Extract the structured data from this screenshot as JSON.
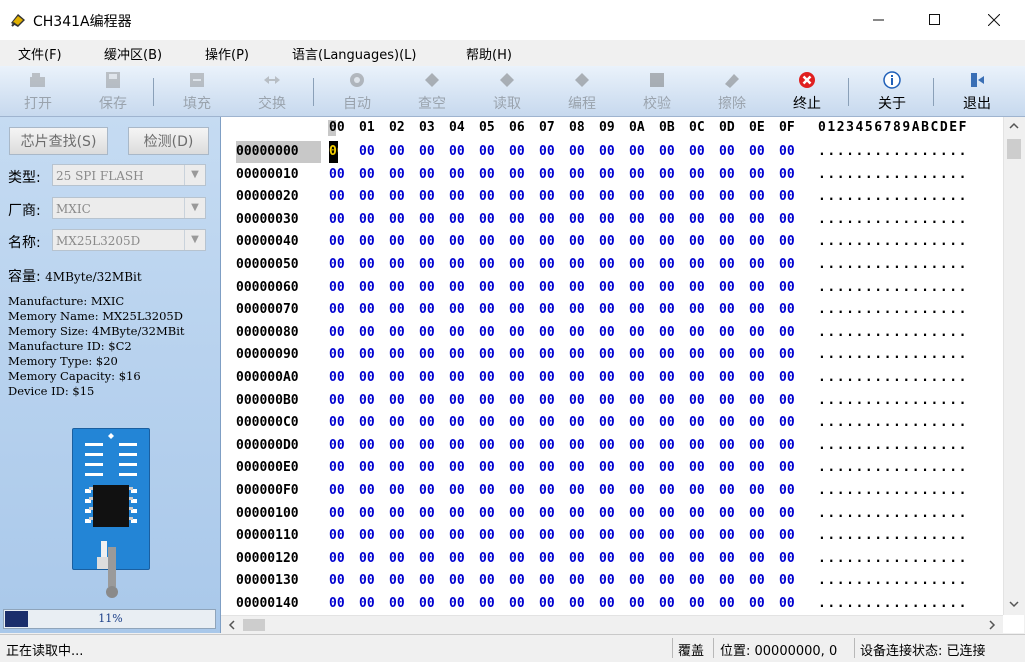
{
  "window": {
    "title": "CH341A编程器"
  },
  "menu": [
    "文件(F)",
    "缓冲区(B)",
    "操作(P)",
    "语言(Languages)(L)",
    "帮助(H)"
  ],
  "toolbar": [
    {
      "label": "打开",
      "icon": "open-icon",
      "enabled": false
    },
    {
      "label": "保存",
      "icon": "save-icon",
      "enabled": false
    },
    {
      "label": "填充",
      "icon": "fill-icon",
      "enabled": false
    },
    {
      "label": "交换",
      "icon": "swap-icon",
      "enabled": false
    },
    {
      "label": "自动",
      "icon": "auto-icon",
      "enabled": false
    },
    {
      "label": "查空",
      "icon": "blank-check-icon",
      "enabled": false
    },
    {
      "label": "读取",
      "icon": "read-icon",
      "enabled": false
    },
    {
      "label": "编程",
      "icon": "program-icon",
      "enabled": false
    },
    {
      "label": "校验",
      "icon": "verify-icon",
      "enabled": false
    },
    {
      "label": "擦除",
      "icon": "erase-icon",
      "enabled": false
    },
    {
      "label": "终止",
      "icon": "stop-icon",
      "enabled": true
    },
    {
      "label": "关于",
      "icon": "info-icon",
      "enabled": true
    },
    {
      "label": "退出",
      "icon": "exit-icon",
      "enabled": true
    }
  ],
  "left": {
    "chip_search": "芯片查找(S)",
    "detect": "检测(D)",
    "type_label": "类型:",
    "type_value": "25 SPI FLASH",
    "vendor_label": "厂商:",
    "vendor_value": "MXIC",
    "name_label": "名称:",
    "name_value": "MX25L3205D",
    "capacity_label": "容量:",
    "capacity_value": "4MByte/32MBit",
    "info": [
      "Manufacture: MXIC",
      "Memory Name: MX25L3205D",
      "Memory Size: 4MByte/32MBit",
      "Manufacture ID: $C2",
      "Memory Type: $20",
      "Memory Capacity: $16",
      "Device ID: $15"
    ],
    "progress_percent": 11,
    "progress_text": "11%"
  },
  "hex": {
    "columns": [
      "00",
      "01",
      "02",
      "03",
      "04",
      "05",
      "06",
      "07",
      "08",
      "09",
      "0A",
      "0B",
      "0C",
      "0D",
      "0E",
      "0F"
    ],
    "ascii_header": "0123456789ABCDEF",
    "addresses": [
      "00000000",
      "00000010",
      "00000020",
      "00000030",
      "00000040",
      "00000050",
      "00000060",
      "00000070",
      "00000080",
      "00000090",
      "000000A0",
      "000000B0",
      "000000C0",
      "000000D0",
      "000000E0",
      "000000F0",
      "00000100",
      "00000110",
      "00000120",
      "00000130",
      "00000140"
    ],
    "byte_value": "00",
    "ascii_value": "................"
  },
  "status": {
    "message": "正在读取中...",
    "mode": "覆盖",
    "position": "位置: 00000000, 0",
    "connection": "设备连接状态: 已连接"
  },
  "colors": {
    "hex_bytes": "#0000d0",
    "toolbar_top": "#eaf2fb",
    "panel": "#b7d0ec",
    "stop_red": "#e02020"
  }
}
